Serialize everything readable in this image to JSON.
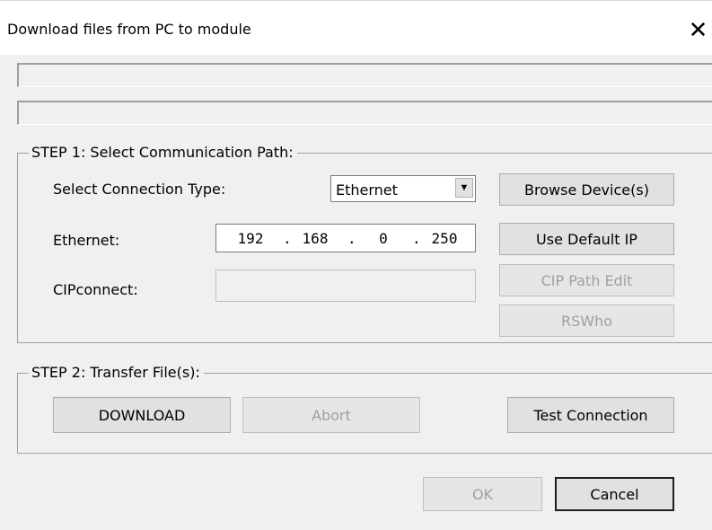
{
  "window": {
    "title": "Download files from PC to module",
    "close_glyph": "✕"
  },
  "step1": {
    "legend": "STEP 1: Select Communication Path:",
    "connection_type_label": "Select Connection Type:",
    "connection_type_value": "Ethernet",
    "connection_type_arrow": "▼",
    "ethernet_label": "Ethernet:",
    "ip": [
      "192",
      "168",
      "0",
      "250"
    ],
    "ip_dot": ".",
    "cipconnect_label": "CIPconnect:",
    "cipconnect_value": "",
    "browse_button": "Browse Device(s)",
    "default_ip_button": "Use Default IP",
    "cip_path_button": "CIP Path Edit",
    "rswho_button": "RSWho"
  },
  "step2": {
    "legend": "STEP 2: Transfer File(s):",
    "download_button": "DOWNLOAD",
    "abort_button": "Abort",
    "test_button": "Test Connection"
  },
  "footer": {
    "ok_button": "OK",
    "cancel_button": "Cancel"
  },
  "icons": {
    "close": "close-icon",
    "dropdown": "chevron-down-icon"
  }
}
